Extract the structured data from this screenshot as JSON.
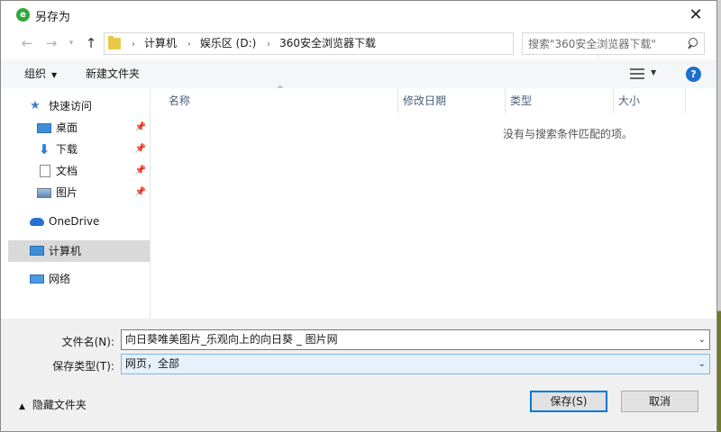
{
  "window": {
    "title": "另存为",
    "app_icon_letter": "e"
  },
  "nav": {
    "path": [
      "计算机",
      "娱乐区 (D:)",
      "360安全浏览器下载"
    ],
    "search_placeholder": "搜索\"360安全浏览器下载\""
  },
  "toolbar": {
    "organize": "组织",
    "new_folder": "新建文件夹"
  },
  "sidebar": {
    "quick_access": "快速访问",
    "items": [
      {
        "label": "桌面",
        "icon": "desktop-icon",
        "pinned": true
      },
      {
        "label": "下载",
        "icon": "download-icon",
        "pinned": true
      },
      {
        "label": "文档",
        "icon": "document-icon",
        "pinned": true
      },
      {
        "label": "图片",
        "icon": "pictures-icon",
        "pinned": true
      }
    ],
    "onedrive": "OneDrive",
    "computer": "计算机",
    "network": "网络",
    "selected": "计算机"
  },
  "columns": {
    "name": "名称",
    "date": "修改日期",
    "type": "类型",
    "size": "大小"
  },
  "empty_message": "没有与搜索条件匹配的项。",
  "form": {
    "filename_label": "文件名(N):",
    "filename_value": "向日葵唯美图片_乐观向上的向日葵 _ 图片网",
    "filetype_label": "保存类型(T):",
    "filetype_value": "网页，全部"
  },
  "footer": {
    "hide_folders": "隐藏文件夹",
    "save": "保存(S)",
    "cancel": "取消"
  },
  "colors": {
    "accent": "#0078d7",
    "help": "#1a6fd1",
    "selected_bg": "#d9d9d9"
  }
}
